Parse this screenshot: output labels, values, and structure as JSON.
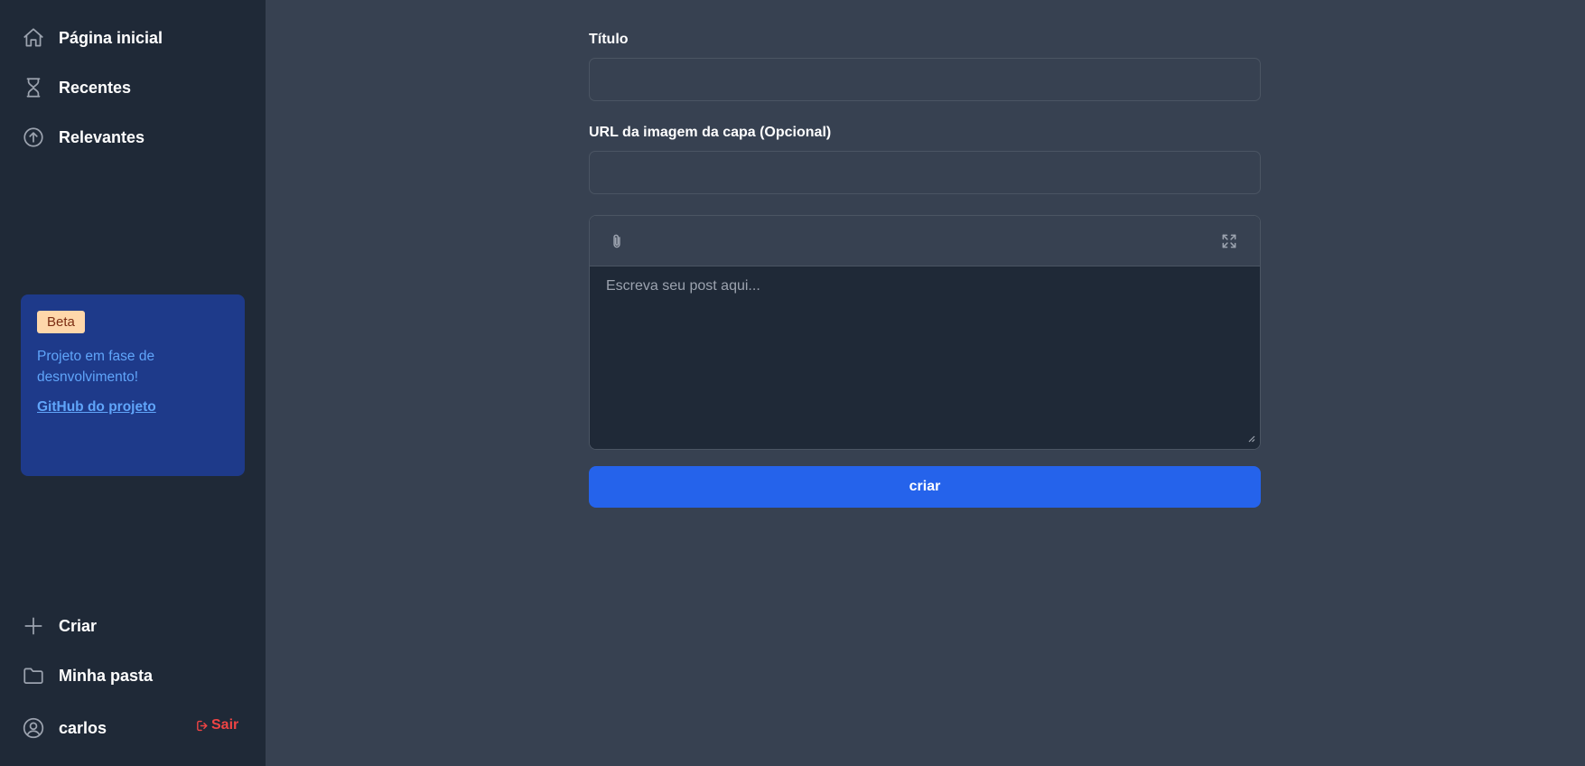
{
  "sidebar": {
    "nav_top": [
      {
        "label": "Página inicial",
        "icon": "home-icon"
      },
      {
        "label": "Recentes",
        "icon": "hourglass-icon"
      },
      {
        "label": "Relevantes",
        "icon": "arrow-up-circle-icon"
      }
    ],
    "beta_card": {
      "badge": "Beta",
      "text": "Projeto em fase de desnvolvimento!",
      "link": "GitHub do projeto"
    },
    "nav_bottom": [
      {
        "label": "Criar",
        "icon": "plus-icon"
      },
      {
        "label": "Minha pasta",
        "icon": "folder-icon"
      }
    ],
    "user": {
      "name": "carlos",
      "icon": "user-circle-icon"
    },
    "logout": {
      "label": "Sair",
      "icon": "logout-icon"
    }
  },
  "form": {
    "title_label": "Título",
    "title_value": "",
    "cover_label": "URL da imagem da capa (Opcional)",
    "cover_value": "",
    "editor": {
      "placeholder": "Escreva seu post aqui...",
      "tools": [
        "paperclip-icon",
        "fullscreen-icon"
      ]
    },
    "submit_label": "criar"
  },
  "colors": {
    "sidebar_bg": "#1f2937",
    "main_bg": "#374151",
    "accent": "#2563eb",
    "beta_card_bg": "#1e3a8a",
    "beta_badge_bg": "#fed7aa",
    "logout": "#ef4444"
  }
}
